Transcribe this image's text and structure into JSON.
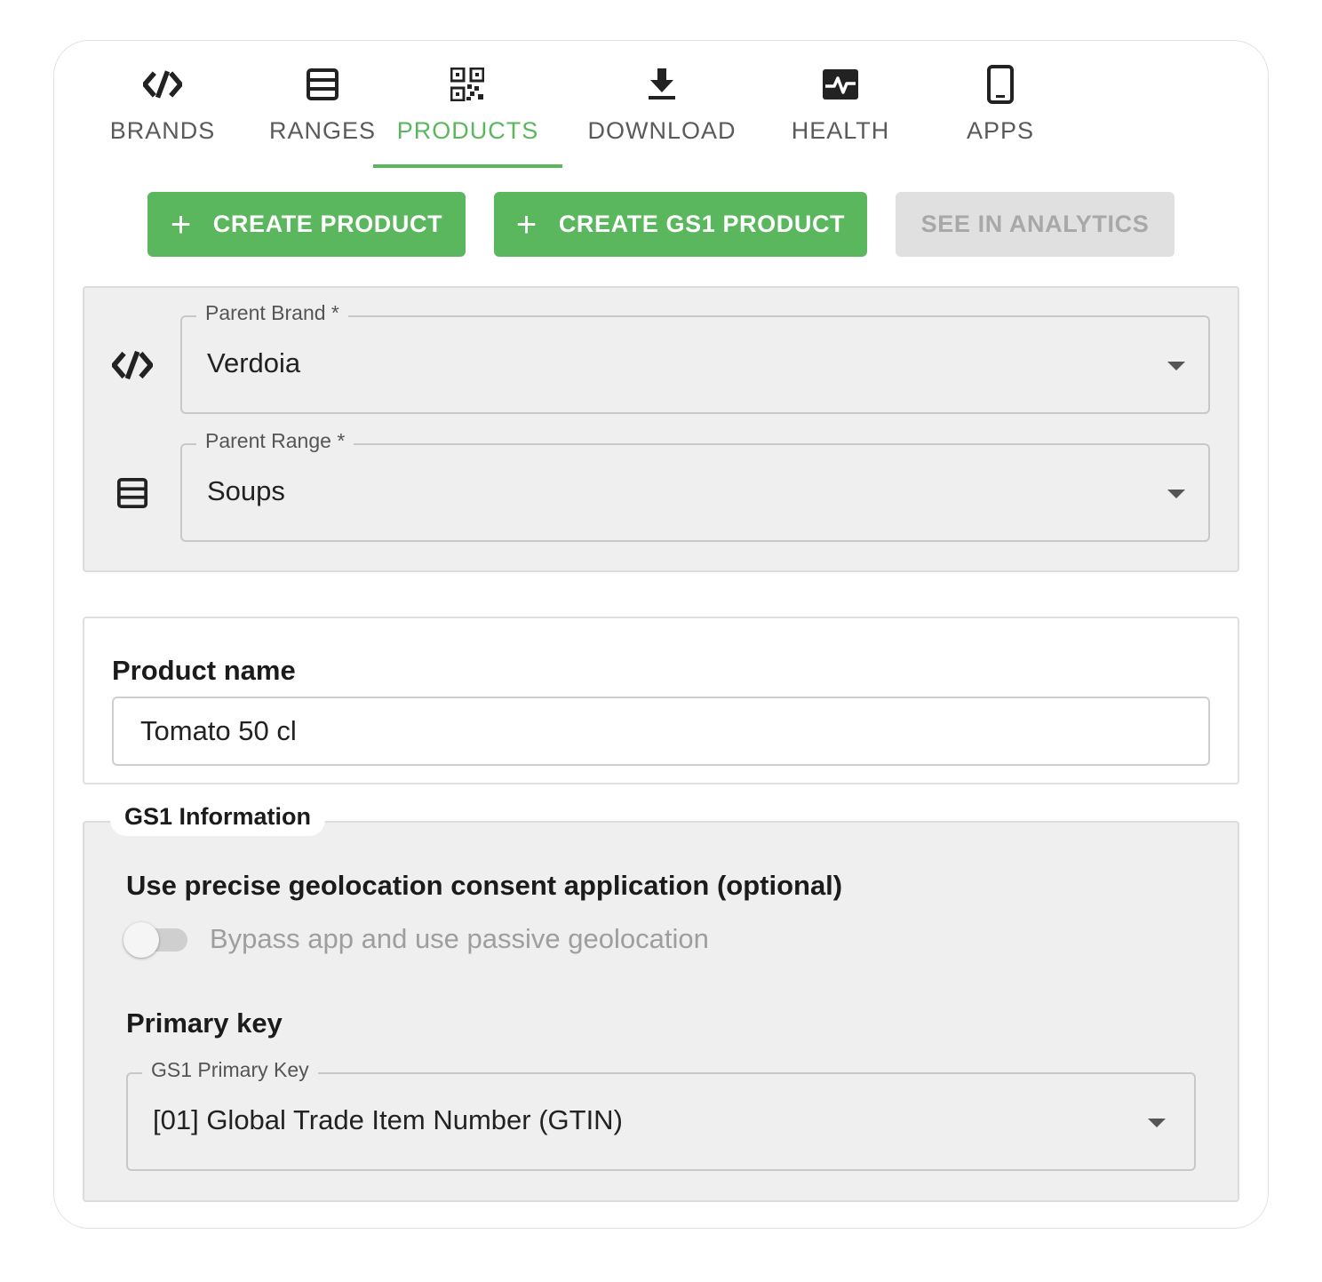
{
  "tabs": [
    {
      "label": "BRANDS",
      "icon": "brand-code-icon",
      "active": false
    },
    {
      "label": "RANGES",
      "icon": "list-table-icon",
      "active": false
    },
    {
      "label": "PRODUCTS",
      "icon": "qr-code-icon",
      "active": true
    },
    {
      "label": "DOWNLOAD",
      "icon": "download-icon",
      "active": false
    },
    {
      "label": "HEALTH",
      "icon": "health-pulse-icon",
      "active": false
    },
    {
      "label": "APPS",
      "icon": "smartphone-icon",
      "active": false
    }
  ],
  "actions": {
    "create_product": "CREATE PRODUCT",
    "create_gs1_product": "CREATE GS1 PRODUCT",
    "see_in_analytics": "SEE IN ANALYTICS",
    "plus_glyph": "+"
  },
  "parent_brand": {
    "label": "Parent Brand *",
    "value": "Verdoia"
  },
  "parent_range": {
    "label": "Parent Range *",
    "value": "Soups"
  },
  "product_name": {
    "label": "Product name",
    "value": "Tomato 50 cl"
  },
  "gs1": {
    "section_title": "GS1 Information",
    "geolocation_heading": "Use precise geolocation consent application (optional)",
    "toggle_label": "Bypass app and use passive geolocation",
    "toggle_on": false,
    "primary_key_heading": "Primary key",
    "primary_key_field_label": "GS1 Primary Key",
    "primary_key_value": "[01] Global Trade Item Number (GTIN)"
  },
  "colors": {
    "accent": "#5bb75d",
    "disabled_bg": "#e0e0e0",
    "panel_bg": "#efefef"
  }
}
